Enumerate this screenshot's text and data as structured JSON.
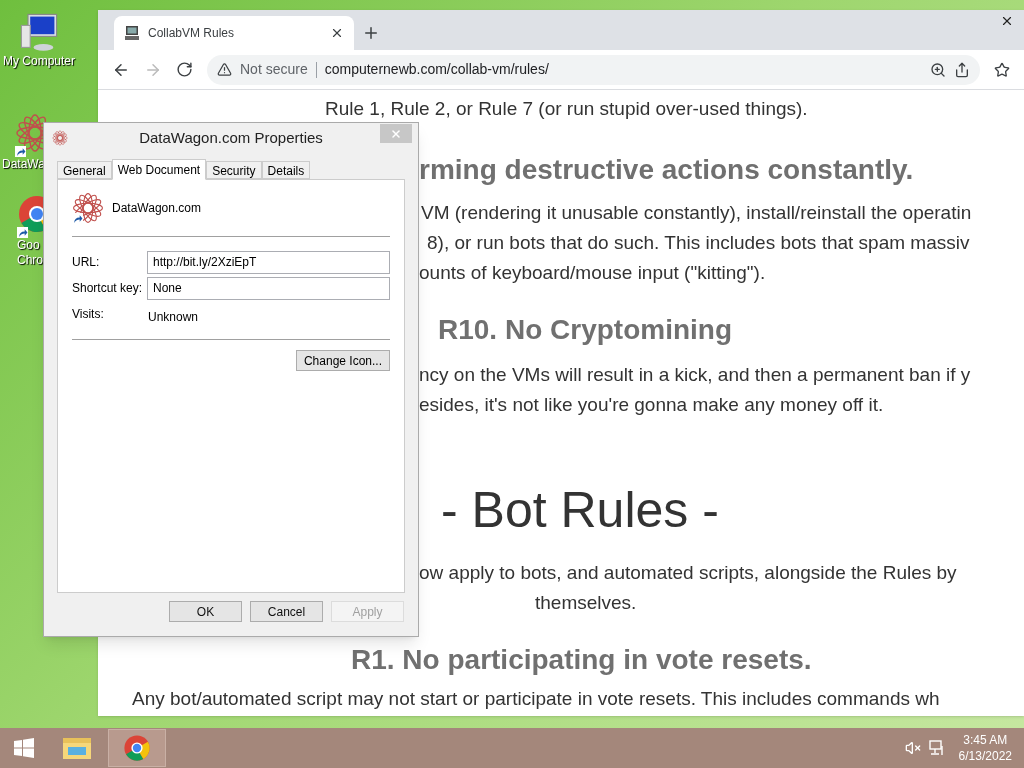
{
  "desktop_icons": [
    {
      "lines": [
        "My Computer"
      ],
      "kind": "computer"
    },
    {
      "lines": [
        "DataWa"
      ],
      "kind": "shortcut-star"
    },
    {
      "lines": [
        "Goo",
        "Chro"
      ],
      "kind": "shortcut-chrome"
    }
  ],
  "browser": {
    "tab": {
      "title": "CollabVM Rules",
      "selected": true
    },
    "toolbar": {
      "back_disabled": false,
      "forward_disabled": true,
      "security": "Not secure",
      "url": "computernewb.com/collab-vm/rules/"
    },
    "content": [
      {
        "kind": "para",
        "text": "Rule 1, Rule 2, or Rule 7 (or run stupid over-used things)."
      },
      {
        "kind": "heading",
        "text": "rming destructive actions constantly."
      },
      {
        "kind": "para",
        "text": "VM (rendering it unusable constantly), install/reinstall the operatin"
      },
      {
        "kind": "para",
        "text": "8), or run bots that do such. This includes bots that spam massiv"
      },
      {
        "kind": "para",
        "text": "ounts of keyboard/mouse input (\"kitting\")."
      },
      {
        "kind": "heading",
        "text": "R10. No Cryptomining"
      },
      {
        "kind": "para",
        "text": "ncy on the VMs will result in a kick, and then a permanent ban if y"
      },
      {
        "kind": "para",
        "text": "esides, it's not like you're gonna make any money off it."
      },
      {
        "kind": "title",
        "text": "- Bot Rules -"
      },
      {
        "kind": "para",
        "text": "ow apply to bots, and automated scripts, alongside the Rules by"
      },
      {
        "kind": "para",
        "text": "themselves."
      },
      {
        "kind": "heading",
        "text": "R1. No participating in vote resets."
      },
      {
        "kind": "para",
        "text": "Any bot/automated script may not start or participate in vote resets. This includes commands wh"
      }
    ]
  },
  "dialog": {
    "title": "DataWagon.com Properties",
    "tabs": [
      {
        "label": "General",
        "selected": false
      },
      {
        "label": "Web Document",
        "selected": true
      },
      {
        "label": "Security",
        "selected": false
      },
      {
        "label": "Details",
        "selected": false
      }
    ],
    "name": "DataWagon.com",
    "fields": [
      {
        "label": "URL:",
        "value": "http://bit.ly/2XziEpT",
        "kind": "input"
      },
      {
        "label": "Shortcut key:",
        "value": "None",
        "kind": "input"
      },
      {
        "label": "Visits:",
        "value": "Unknown",
        "kind": "text"
      }
    ],
    "change_icon": "Change Icon...",
    "buttons": [
      {
        "label": "OK",
        "disabled": false
      },
      {
        "label": "Cancel",
        "disabled": false
      },
      {
        "label": "Apply",
        "disabled": true
      }
    ]
  },
  "taskbar": {
    "apps": [
      {
        "kind": "explorer",
        "active": false
      },
      {
        "kind": "chrome",
        "active": true
      }
    ],
    "volume_muted": true,
    "time": "3:45 AM",
    "date": "6/13/2022"
  }
}
